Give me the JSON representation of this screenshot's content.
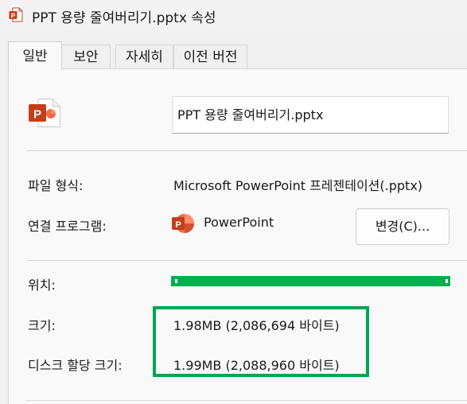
{
  "window": {
    "title": "PPT 용량 줄여버리기.pptx 속성",
    "icon": "powerpoint-file-icon"
  },
  "tabs": [
    {
      "label": "일반",
      "active": true
    },
    {
      "label": "보안",
      "active": false
    },
    {
      "label": "자세히",
      "active": false
    },
    {
      "label": "이전 버전",
      "active": false
    }
  ],
  "general": {
    "file_icon": "powerpoint-file-icon",
    "filename": "PPT 용량 줄여버리기.pptx",
    "file_type": {
      "label": "파일 형식:",
      "value": "Microsoft PowerPoint 프레젠테이션(.pptx)"
    },
    "opens_with": {
      "label": "연결 프로그램:",
      "app_name": "PowerPoint",
      "app_icon": "powerpoint-app-icon",
      "change_button": "변경(C)..."
    },
    "location": {
      "label": "위치:",
      "value_redacted": true,
      "redaction_color": "#00b050"
    },
    "size": {
      "label": "크기:",
      "value": "1.98MB (2,086,694 바이트)"
    },
    "size_on_disk": {
      "label": "디스크 할당 크기:",
      "value": "1.99MB (2,088,960 바이트)"
    },
    "highlight_color": "#00a651"
  }
}
